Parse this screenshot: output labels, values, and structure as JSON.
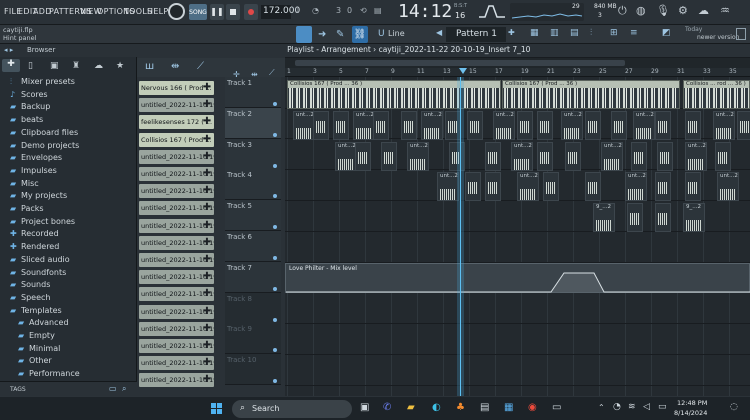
{
  "menu": [
    "FILE",
    "EDIT",
    "ADD",
    "PATTERNS",
    "VIEW",
    "OPTIONS",
    "TOOLS",
    "HELP"
  ],
  "transport": {
    "mode": "SONG",
    "tempo": "172.000",
    "pattern": "Pattern 1",
    "time": "14:12",
    "time_small": "16",
    "time_label": "B:S:T",
    "cpu": "29",
    "mem": "840 MB",
    "voices": "3",
    "tick_a": "3",
    "tick_b": "0"
  },
  "hint": {
    "file": "caytiji.flp",
    "panel": "Hint panel",
    "update_day": "Today",
    "update_text": "newer version"
  },
  "snap": "Line",
  "playlist": {
    "title": "Playlist - Arrangement",
    "breadcrumb": "caytiji_2022-11-22 20-10-19_Insert 7_10",
    "bars": [
      "1",
      "3",
      "5",
      "7",
      "9",
      "11",
      "13",
      "15",
      "17",
      "19",
      "21",
      "23",
      "25",
      "27",
      "29",
      "31",
      "33",
      "35"
    ]
  },
  "browser": {
    "title": "Browser",
    "items": [
      {
        "label": "Mixer presets",
        "icon": "mixer-icon"
      },
      {
        "label": "Scores",
        "icon": "note-icon"
      },
      {
        "label": "Backup",
        "icon": "folder-icon"
      },
      {
        "label": "beats",
        "icon": "folder-icon"
      },
      {
        "label": "Clipboard files",
        "icon": "folder-icon"
      },
      {
        "label": "Demo projects",
        "icon": "folder-icon"
      },
      {
        "label": "Envelopes",
        "icon": "folder-icon"
      },
      {
        "label": "Impulses",
        "icon": "folder-icon"
      },
      {
        "label": "Misc",
        "icon": "folder-icon"
      },
      {
        "label": "My projects",
        "icon": "folder-icon"
      },
      {
        "label": "Packs",
        "icon": "folder-icon"
      },
      {
        "label": "Project bones",
        "icon": "folder-icon"
      },
      {
        "label": "Recorded",
        "icon": "plus-icon"
      },
      {
        "label": "Rendered",
        "icon": "plus-icon"
      },
      {
        "label": "Sliced audio",
        "icon": "folder-icon"
      },
      {
        "label": "Soundfonts",
        "icon": "folder-icon"
      },
      {
        "label": "Sounds",
        "icon": "folder-icon"
      },
      {
        "label": "Speech",
        "icon": "folder-icon"
      },
      {
        "label": "Templates",
        "icon": "folder-icon"
      },
      {
        "label": "Advanced",
        "icon": "folder-icon"
      },
      {
        "label": "Empty",
        "icon": "folder-icon"
      },
      {
        "label": "Minimal",
        "icon": "folder-icon"
      },
      {
        "label": "Other",
        "icon": "folder-icon"
      },
      {
        "label": "Performance",
        "icon": "folder-icon"
      }
    ],
    "footer": "TAGS"
  },
  "patterns": [
    {
      "label": "Nervous 166 ( Prod ...",
      "sel": true
    },
    {
      "label": "untitled_2022-11-10 19-...",
      "sel": false
    },
    {
      "label": "feelikesenses 172 ( ...",
      "sel": true
    },
    {
      "label": "Collisios 167 ( Prod ...",
      "sel": true
    },
    {
      "label": "untitled_2022-11-10 19-...",
      "sel": false
    },
    {
      "label": "untitled_2022-11-10 19-...",
      "sel": false
    },
    {
      "label": "untitled_2022-11-10 19-...",
      "sel": false
    },
    {
      "label": "untitled_2022-11-10 19-...",
      "sel": false
    },
    {
      "label": "untitled_2022-11-10 19-...",
      "sel": false
    },
    {
      "label": "untitled_2022-11-10 19-...",
      "sel": false
    },
    {
      "label": "untitled_2022-11-10 19-...",
      "sel": false
    },
    {
      "label": "untitled_2022-11-10 19-...",
      "sel": false
    },
    {
      "label": "untitled_2022-11-10 19-...",
      "sel": false
    },
    {
      "label": "untitled_2022-11-10 19-...",
      "sel": false
    },
    {
      "label": "untitled_2022-11-10 19-...",
      "sel": false
    },
    {
      "label": "untitled_2022-11-10 19-...",
      "sel": false
    },
    {
      "label": "untitled_2022-11-10 19-...",
      "sel": false
    },
    {
      "label": "untitled_2022-11-10 19-...",
      "sel": false
    }
  ],
  "tracks": [
    "Track 1",
    "Track 2",
    "Track 3",
    "Track 4",
    "Track 5",
    "Track 6",
    "Track 7",
    "Track 8",
    "Track 9",
    "Track 10"
  ],
  "clips": {
    "t1a": "Collisios 167 ( Prod ... 36 )",
    "t1b": "Collisios 167 ( Prod ... 36 )",
    "t1c": "Collisios ... rod ... 36 )",
    "t2": "unt...2",
    "t3": "unt...2",
    "t4": "unt...2",
    "t5": "9_...2",
    "auto": "Love Philter - Mix level"
  },
  "taskbar": {
    "search": "Search",
    "time": "12:48 PM",
    "date": "8/14/2024"
  }
}
